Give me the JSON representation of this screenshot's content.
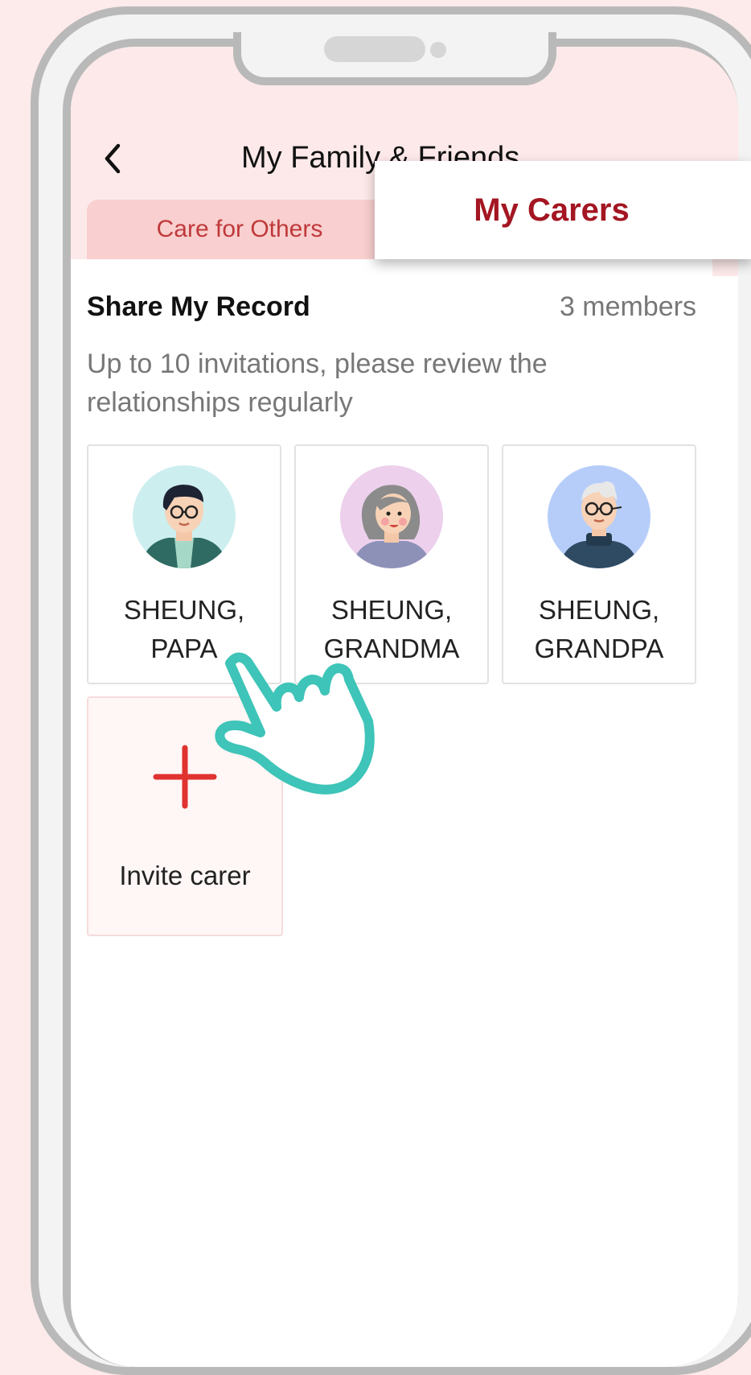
{
  "header": {
    "title": "My Family & Friends"
  },
  "tabs": [
    {
      "label": "Care for Others",
      "active": false
    },
    {
      "label": "My Carers",
      "active": true
    }
  ],
  "section": {
    "title": "Share My Record",
    "count": "3 members",
    "hint": "Up to 10 invitations, please review the relationships regularly"
  },
  "carers": [
    {
      "line1": "SHEUNG,",
      "line2": "PAPA",
      "avatar": "man-with-glasses-icon"
    },
    {
      "line1": "SHEUNG,",
      "line2": "GRANDMA",
      "avatar": "grandma-icon"
    },
    {
      "line1": "SHEUNG,",
      "line2": "GRANDPA",
      "avatar": "grandpa-icon"
    }
  ],
  "invite": {
    "label": "Invite carer"
  },
  "colors": {
    "accent": "#a31622",
    "tab_bg": "#f9cfcf",
    "plus": "#e0322f",
    "hand": "#3ec4b8"
  }
}
